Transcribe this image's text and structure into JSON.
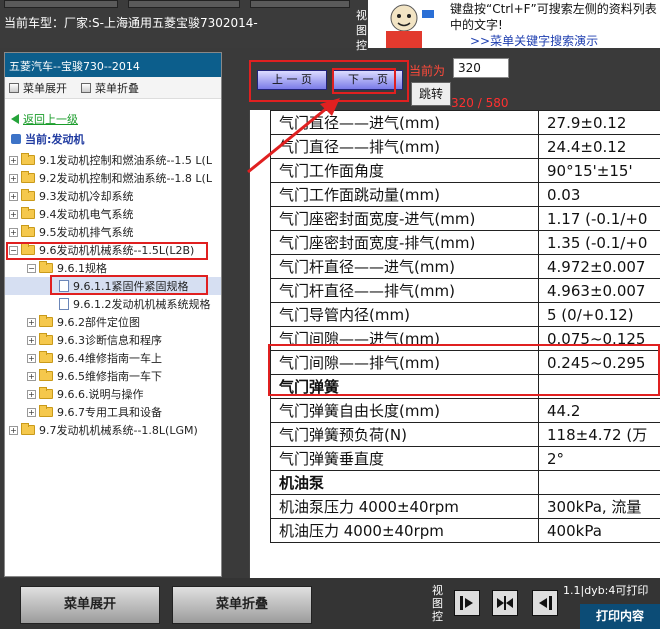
{
  "header": {
    "vehicle": "当前车型：厂家:S-上海通用五菱宝骏7302014-",
    "side_label": "视图控",
    "tip_text": "键盘按“Ctrl+F”可搜索左侧的资料列表中的文字!",
    "tip_link": ">>菜单关键字搜索演示"
  },
  "sidebar": {
    "title": "五菱汽车--宝骏730--2014",
    "expand": "菜单展开",
    "collapse": "菜单折叠",
    "back": "返回上一级",
    "current": "当前:发动机",
    "items": [
      {
        "label": "9.1发动机控制和燃油系统--1.5 L(L",
        "level": 0
      },
      {
        "label": "9.2发动机控制和燃油系统--1.8 L(L",
        "level": 0
      },
      {
        "label": "9.3发动机冷却系统",
        "level": 0
      },
      {
        "label": "9.4发动机电气系统",
        "level": 0
      },
      {
        "label": "9.5发动机排气系统",
        "level": 0
      },
      {
        "label": "9.6发动机机械系统--1.5L(L2B)",
        "level": 0
      },
      {
        "label": "9.6.1规格",
        "level": 1
      },
      {
        "label": "9.6.1.1紧固件紧固规格",
        "level": 2
      },
      {
        "label": "9.6.1.2发动机机械系统规格",
        "level": 2
      },
      {
        "label": "9.6.2部件定位图",
        "level": 1
      },
      {
        "label": "9.6.3诊断信息和程序",
        "level": 1
      },
      {
        "label": "9.6.4维修指南一车上",
        "level": 1
      },
      {
        "label": "9.6.5维修指南一车下",
        "level": 1
      },
      {
        "label": "9.6.6.说明与操作",
        "level": 1
      },
      {
        "label": "9.6.7专用工具和设备",
        "level": 1
      },
      {
        "label": "9.7发动机机械系统--1.8L(LGM)",
        "level": 0
      }
    ]
  },
  "pager": {
    "prev": "上 一 页",
    "next": "下 一 页",
    "label": "当前为",
    "value": "320",
    "go": "跳转",
    "count": "320 / 580"
  },
  "doc": {
    "rows": [
      {
        "k": "气门直径——进气(mm)",
        "v": "27.9±0.12"
      },
      {
        "k": "气门直径——排气(mm)",
        "v": "24.4±0.12"
      },
      {
        "k": "气门工作面角度",
        "v": "90°15'±15'"
      },
      {
        "k": "气门工作面跳动量(mm)",
        "v": "0.03"
      },
      {
        "k": "气门座密封面宽度-进气(mm)",
        "v": "1.17 (-0.1/+0"
      },
      {
        "k": "气门座密封面宽度-排气(mm)",
        "v": "1.35 (-0.1/+0"
      },
      {
        "k": "气门杆直径——进气(mm)",
        "v": "4.972±0.007"
      },
      {
        "k": "气门杆直径——排气(mm)",
        "v": "4.963±0.007"
      },
      {
        "k": "气门导管内径(mm)",
        "v": "5 (0/+0.12)"
      },
      {
        "k": "气门间隙——进气(mm)",
        "v": "0.075~0.125"
      },
      {
        "k": "气门间隙——排气(mm)",
        "v": "0.245~0.295"
      },
      {
        "k": "气门弹簧",
        "v": "",
        "section": true
      },
      {
        "k": "气门弹簧自由长度(mm)",
        "v": "44.2"
      },
      {
        "k": "气门弹簧预负荷(N)",
        "v": "118±4.72 (万"
      },
      {
        "k": "气门弹簧垂直度",
        "v": "2°"
      },
      {
        "k": "机油泵",
        "v": "",
        "section": true
      },
      {
        "k": "机油泵压力 4000±40rpm",
        "v": "300kPa, 流量"
      },
      {
        "k": "机油压力 4000±40rpm",
        "v": "400kPa"
      }
    ]
  },
  "footer": {
    "expand": "菜单展开",
    "collapse": "菜单折叠",
    "view_label": "视图控",
    "info": "1.1|dyb:4可打印",
    "print": "打印内容"
  }
}
